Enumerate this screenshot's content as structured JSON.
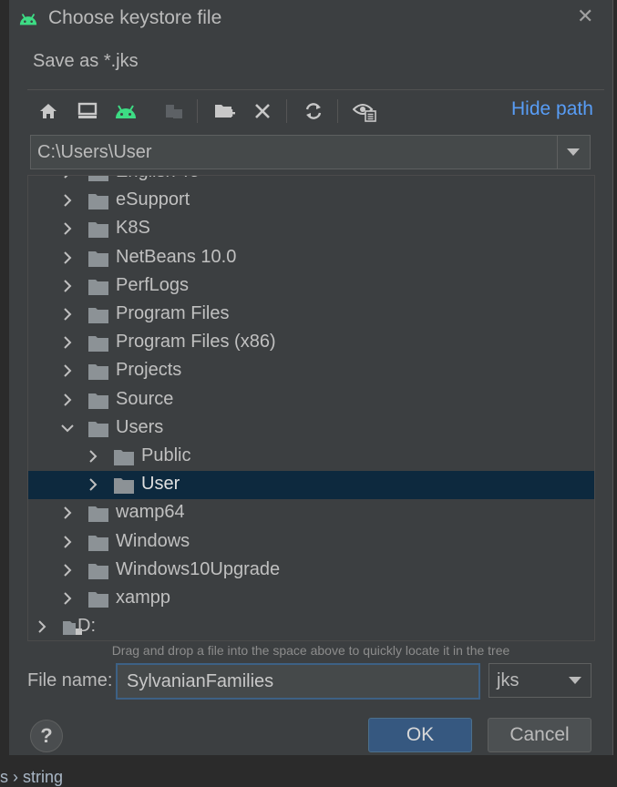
{
  "background": {
    "crumb": "s  ›  string"
  },
  "dialog": {
    "title": "Choose keystore file",
    "subtitle": "Save as *.jks",
    "close_icon": "close-icon"
  },
  "toolbar": {
    "buttons": [
      {
        "name": "home-icon"
      },
      {
        "name": "desktop-icon"
      },
      {
        "name": "android-icon"
      },
      {
        "name": "module-icon"
      },
      {
        "name": "new-folder-icon"
      },
      {
        "name": "delete-icon"
      },
      {
        "name": "refresh-icon"
      },
      {
        "name": "show-hidden-icon"
      }
    ],
    "hide_path_label": "Hide path"
  },
  "path": {
    "value": "C:\\Users\\User"
  },
  "tree": {
    "items": [
      {
        "label": "English To",
        "depth": 1,
        "expanded": false,
        "selected": false
      },
      {
        "label": "eSupport",
        "depth": 1,
        "expanded": false,
        "selected": false
      },
      {
        "label": "K8S",
        "depth": 1,
        "expanded": false,
        "selected": false
      },
      {
        "label": "NetBeans 10.0",
        "depth": 1,
        "expanded": false,
        "selected": false
      },
      {
        "label": "PerfLogs",
        "depth": 1,
        "expanded": false,
        "selected": false
      },
      {
        "label": "Program Files",
        "depth": 1,
        "expanded": false,
        "selected": false
      },
      {
        "label": "Program Files (x86)",
        "depth": 1,
        "expanded": false,
        "selected": false
      },
      {
        "label": "Projects",
        "depth": 1,
        "expanded": false,
        "selected": false
      },
      {
        "label": "Source",
        "depth": 1,
        "expanded": false,
        "selected": false
      },
      {
        "label": "Users",
        "depth": 1,
        "expanded": true,
        "selected": false
      },
      {
        "label": "Public",
        "depth": 2,
        "expanded": false,
        "selected": false
      },
      {
        "label": "User",
        "depth": 2,
        "expanded": false,
        "selected": true
      },
      {
        "label": "wamp64",
        "depth": 1,
        "expanded": false,
        "selected": false
      },
      {
        "label": "Windows",
        "depth": 1,
        "expanded": false,
        "selected": false
      },
      {
        "label": "Windows10Upgrade",
        "depth": 1,
        "expanded": false,
        "selected": false
      },
      {
        "label": "xampp",
        "depth": 1,
        "expanded": false,
        "selected": false
      },
      {
        "label": "D:",
        "depth": 0,
        "expanded": false,
        "selected": false,
        "drive": true
      }
    ]
  },
  "hint": "Drag and drop a file into the space above to quickly locate it in the tree",
  "file_name": {
    "label": "File name:",
    "value": "SylvanianFamilies"
  },
  "file_type": {
    "selected": "jks"
  },
  "buttons": {
    "ok": "OK",
    "cancel": "Cancel",
    "help": "?"
  },
  "colors": {
    "accent": "#589df6",
    "selection": "#0d293e",
    "android_green": "#3ddc84",
    "folder": "#8c9296"
  }
}
